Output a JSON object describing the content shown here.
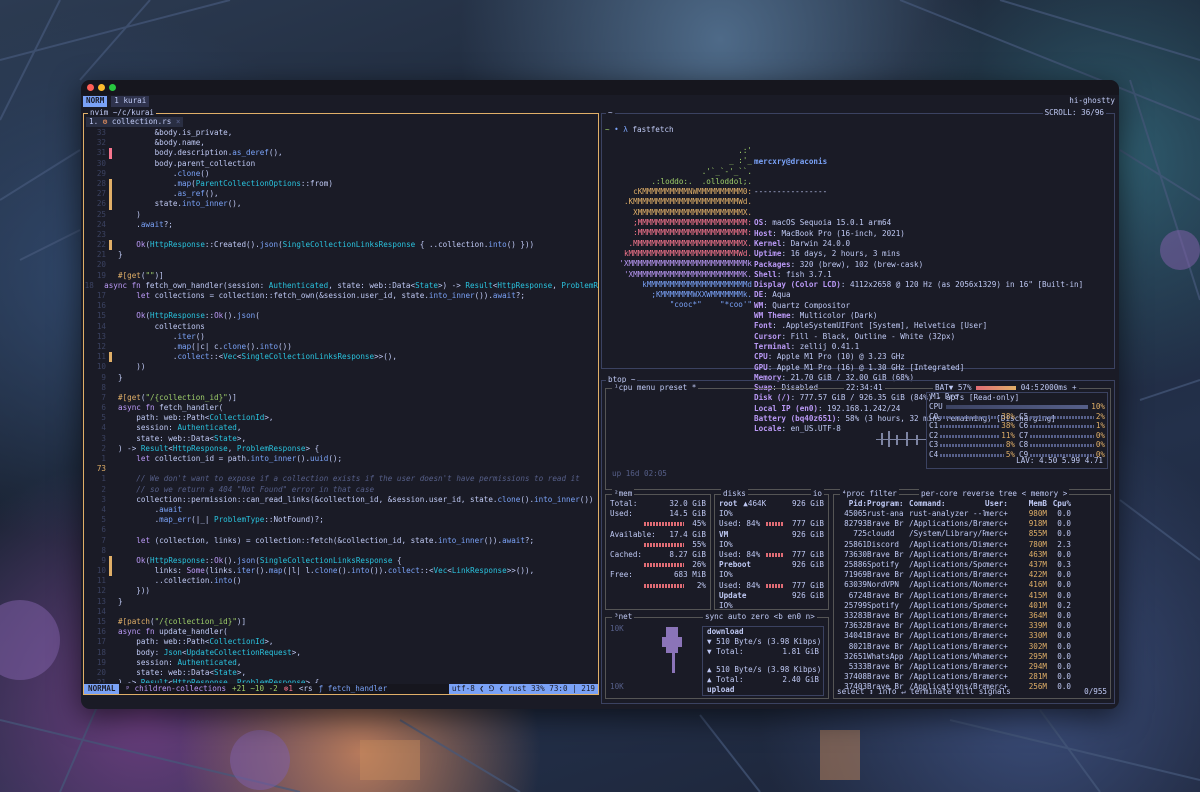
{
  "zellij": {
    "mode": "NORM",
    "tab": "1 kurai",
    "session": "hi-ghostty"
  },
  "nvim": {
    "pane_title": "nvim ~/c/kurai",
    "tab": {
      "index": "1.",
      "name": "collection.rs",
      "close": "×"
    },
    "status": {
      "mode": "NORMAL",
      "branch": "ᵖ children-collections",
      "diff": "+21 ~10 -2",
      "errors": "⊗1",
      "lsp": "<rs",
      "func": "ƒ fetch_handler",
      "enc": "utf-8",
      "icons": "❮ ⅁ ❮",
      "lang": "rust",
      "percent": "33%",
      "pos": "73:0 | 219"
    }
  },
  "fastfetch": {
    "prompt_dir": "~",
    "prompt_cmd": "fastfetch",
    "logo": [
      "                 .:'",
      "              _ :'_",
      "           .'`_`-'_``.",
      "  .:loddo:.  .olloddol;.",
      "  cKMMMMMMMMMMNWMMMMMMMMMM0:",
      ".KMMMMMMMMMMMMMMMMMMMMMMMWd.",
      "XMMMMMMMMMMMMMMMMMMMMMMMX.",
      ";MMMMMMMMMMMMMMMMMMMMMMMM:",
      ":MMMMMMMMMMMMMMMMMMMMMMMM:",
      ".MMMMMMMMMMMMMMMMMMMMMMMMX.",
      "kMMMMMMMMMMMMMMMMMMMMMMMMWd.",
      "'XMMMMMMMMMMMMMMMMMMMMMMMMMMk",
      "'XMMMMMMMMMMMMMMMMMMMMMMMMK.",
      "  kMMMMMMMMMMMMMMMMMMMMMMd",
      "   ;KMMMMMMMWXXWMMMMMMMk.",
      "     \"cooc*\"    \"*coo'\""
    ],
    "user": "mercxry@draconis",
    "sep": "----------------",
    "items": [
      {
        "k": "OS",
        "v": "macOS Sequoia 15.0.1 arm64"
      },
      {
        "k": "Host",
        "v": "MacBook Pro (16-inch, 2021)"
      },
      {
        "k": "Kernel",
        "v": "Darwin 24.0.0"
      },
      {
        "k": "Uptime",
        "v": "16 days, 2 hours, 3 mins"
      },
      {
        "k": "Packages",
        "v": "320 (brew), 102 (brew-cask)"
      },
      {
        "k": "Shell",
        "v": "fish 3.7.1"
      },
      {
        "k": "Display (Color LCD)",
        "v": "4112x2658 @ 120 Hz (as 2056x1329) in 16\" [Built-in]"
      },
      {
        "k": "DE",
        "v": "Aqua"
      },
      {
        "k": "WM",
        "v": "Quartz Compositor"
      },
      {
        "k": "WM Theme",
        "v": "Multicolor (Dark)"
      },
      {
        "k": "Font",
        "v": ".AppleSystemUIFont [System], Helvetica [User]"
      },
      {
        "k": "Cursor",
        "v": "Fill - Black, Outline - White (32px)"
      },
      {
        "k": "Terminal",
        "v": "zellij 0.41.1"
      },
      {
        "k": "CPU",
        "v": "Apple M1 Pro (10) @ 3.23 GHz"
      },
      {
        "k": "GPU",
        "v": "Apple M1 Pro (16) @ 1.30 GHz [Integrated]"
      },
      {
        "k": "Memory",
        "v": "21.70 GiB / 32.00 GiB (68%)"
      },
      {
        "k": "Swap",
        "v": "Disabled"
      },
      {
        "k": "Disk (/)",
        "v": "777.57 GiB / 926.35 GiB (84%) - apfs [Read-only]"
      },
      {
        "k": "Local IP (en0)",
        "v": "192.168.1.242/24"
      },
      {
        "k": "Battery (bq40z651)",
        "v": "58% (3 hours, 32 mins remaining) [Discharging]"
      },
      {
        "k": "Locale",
        "v": "en_US.UTF-8"
      }
    ]
  },
  "btop": {
    "pane_title": "btop ~",
    "header": {
      "cpu": "¹cpu",
      "menu": "menu",
      "preset": "preset *",
      "clock": "22:34:41",
      "battery": "BAT▼ 57%",
      "bat_time": "04:53",
      "interval": "2000ms +"
    },
    "uptime": "up 16d 02:05",
    "cpu_box": {
      "title": "M1 Pro",
      "total_label": "CPU",
      "total": "10%",
      "cores": [
        {
          "l": "C0",
          "v": "38%"
        },
        {
          "l": "C1",
          "v": "38%"
        },
        {
          "l": "C2",
          "v": "11%"
        },
        {
          "l": "C3",
          "v": "8%"
        },
        {
          "l": "C4",
          "v": "5%"
        },
        {
          "l": "C5",
          "v": "2%"
        },
        {
          "l": "C6",
          "v": "1%"
        },
        {
          "l": "C7",
          "v": "0%"
        },
        {
          "l": "C8",
          "v": "0%"
        },
        {
          "l": "C9",
          "v": "0%"
        }
      ],
      "lav": "LAV: 4.50 5.99 4.71"
    },
    "mem": {
      "title": "²mem",
      "rows": [
        {
          "k": "Total:",
          "v": "32.0 GiB"
        },
        {
          "k": "Used:",
          "v": "14.5 GiB"
        },
        {
          "k": "",
          "v": "45%"
        },
        {
          "k": "Available:",
          "v": "17.4 GiB"
        },
        {
          "k": "",
          "v": "55%"
        },
        {
          "k": "Cached:",
          "v": "8.27 GiB"
        },
        {
          "k": "",
          "v": "26%"
        },
        {
          "k": "Free:",
          "v": "683 MiB"
        },
        {
          "k": "",
          "v": "2%"
        }
      ]
    },
    "disks": {
      "title": "disks",
      "io": "io",
      "rows": [
        {
          "k": "root",
          "m": "▲464K",
          "v": "926 GiB"
        },
        {
          "k": "IO%",
          "m": "",
          "v": ""
        },
        {
          "k": "Used: 84%",
          "m": "",
          "v": "777 GiB"
        },
        {
          "k": "VM",
          "m": "",
          "v": "926 GiB"
        },
        {
          "k": "IO%",
          "m": "",
          "v": ""
        },
        {
          "k": "Used: 84%",
          "m": "",
          "v": "777 GiB"
        },
        {
          "k": "Preboot",
          "m": "",
          "v": "926 GiB"
        },
        {
          "k": "IO%",
          "m": "",
          "v": ""
        },
        {
          "k": "Used: 84%",
          "m": "",
          "v": "777 GiB"
        },
        {
          "k": "Update",
          "m": "",
          "v": "926 GiB"
        },
        {
          "k": "IO%",
          "m": "",
          "v": ""
        }
      ]
    },
    "net": {
      "title": "³net",
      "sync": "sync",
      "auto": "auto",
      "zero": "zero",
      "iface": "<b en0 n>",
      "scale_top": "10K",
      "scale_bot": "10K",
      "down_title": "download",
      "down_rate": "▼ 510 Byte/s (3.98 Kibps)",
      "down_total_k": "▼ Total:",
      "down_total_v": "1.81 GiB",
      "up_rate": "▲ 510 Byte/s (3.98 Kibps)",
      "up_total_k": "▲ Total:",
      "up_total_v": "2.40 GiB",
      "up_title": "upload"
    },
    "proc": {
      "title": "⁴proc",
      "filter": "filter",
      "tabs": "per-core reverse tree < memory >",
      "cols": [
        "Pid:",
        "Program:",
        "Command:",
        "User:",
        "MemB",
        "Cpu%"
      ],
      "rows": [
        [
          "45065",
          "rust-ana",
          "rust-analyzer --l",
          "merc+",
          "980M",
          "0.0"
        ],
        [
          "82793",
          "Brave Br",
          "/Applications/Bra",
          "merc+",
          "918M",
          "0.0"
        ],
        [
          "725",
          "cloudd",
          "/System/Library/P",
          "merc+",
          "855M",
          "0.0"
        ],
        [
          "25861",
          "Discord",
          "/Applications/Dis",
          "merc+",
          "780M",
          "2.3"
        ],
        [
          "73630",
          "Brave Br",
          "/Applications/Bra",
          "merc+",
          "463M",
          "0.0"
        ],
        [
          "25886",
          "Spotify",
          "/Applications/Spo",
          "merc+",
          "437M",
          "0.3"
        ],
        [
          "71969",
          "Brave Br",
          "/Applications/Bra",
          "merc+",
          "422M",
          "0.0"
        ],
        [
          "63039",
          "NordVPN",
          "/Applications/Nor",
          "merc+",
          "416M",
          "0.0"
        ],
        [
          "6724",
          "Brave Br",
          "/Applications/Bra",
          "merc+",
          "415M",
          "0.0"
        ],
        [
          "25799",
          "Spotify",
          "/Applications/Spo",
          "merc+",
          "401M",
          "0.2"
        ],
        [
          "33283",
          "Brave Br",
          "/Applications/Bra",
          "merc+",
          "364M",
          "0.0"
        ],
        [
          "73632",
          "Brave Br",
          "/Applications/Bra",
          "merc+",
          "339M",
          "0.0"
        ],
        [
          "34041",
          "Brave Br",
          "/Applications/Bra",
          "merc+",
          "330M",
          "0.0"
        ],
        [
          "8021",
          "Brave Br",
          "/Applications/Bra",
          "merc+",
          "302M",
          "0.0"
        ],
        [
          "32651",
          "WhatsApp",
          "/Applications/Wha",
          "merc+",
          "295M",
          "0.0"
        ],
        [
          "5333",
          "Brave Br",
          "/Applications/Bra",
          "merc+",
          "294M",
          "0.0"
        ],
        [
          "37408",
          "Brave Br",
          "/Applications/Bra",
          "merc+",
          "281M",
          "0.0"
        ],
        [
          "37403",
          "Brave Br",
          "/Applications/Bra",
          "merc+",
          "256M",
          "0.0"
        ]
      ],
      "footer": "select ↕ info ↵ terminate kill signals",
      "count": "0/955"
    }
  },
  "code_lines": [
    {
      "n": "33",
      "t": "        &body.is_private,",
      "g": ""
    },
    {
      "n": "32",
      "t": "        &body.name,",
      "g": ""
    },
    {
      "n": "31",
      "t": "        body.description.as_deref(),",
      "g": "d"
    },
    {
      "n": "30",
      "t": "        body.parent_collection",
      "g": ""
    },
    {
      "n": "29",
      "t": "            .clone()",
      "g": ""
    },
    {
      "n": "28",
      "t": "            .map(ParentCollectionOptions::from)",
      "g": "m"
    },
    {
      "n": "27",
      "t": "            .as_ref(),",
      "g": "m"
    },
    {
      "n": "26",
      "t": "        state.into_inner(),",
      "g": "m"
    },
    {
      "n": "25",
      "t": "    )",
      "g": ""
    },
    {
      "n": "24",
      "t": "    .await?;",
      "g": ""
    },
    {
      "n": "23",
      "t": "",
      "g": ""
    },
    {
      "n": "22",
      "t": "    Ok(HttpResponse::Created().json(SingleCollectionLinksResponse { ..collection.into() }))",
      "g": "m"
    },
    {
      "n": "21",
      "t": "}",
      "g": ""
    },
    {
      "n": "20",
      "t": "",
      "g": ""
    },
    {
      "n": "19",
      "t": "#[get(\"\")]",
      "g": ""
    },
    {
      "n": "18",
      "t": "async fn fetch_own_handler(session: Authenticated, state: web::Data<State>) -> Result<HttpResponse, ProblemR",
      "g": ""
    },
    {
      "n": "17",
      "t": "    let collections = collection::fetch_own(&session.user_id, state.into_inner()).await?;",
      "g": ""
    },
    {
      "n": "16",
      "t": "",
      "g": ""
    },
    {
      "n": "15",
      "t": "    Ok(HttpResponse::Ok().json(",
      "g": ""
    },
    {
      "n": "14",
      "t": "        collections",
      "g": ""
    },
    {
      "n": "13",
      "t": "            .iter()",
      "g": ""
    },
    {
      "n": "12",
      "t": "            .map(|c| c.clone().into())",
      "g": ""
    },
    {
      "n": "11",
      "t": "            .collect::<Vec<SingleCollectionLinksResponse>>(),",
      "g": "m"
    },
    {
      "n": "10",
      "t": "    ))",
      "g": ""
    },
    {
      "n": "9",
      "t": "}",
      "g": ""
    },
    {
      "n": "8",
      "t": "",
      "g": ""
    },
    {
      "n": "7",
      "t": "#[get(\"/{collection_id}\")]",
      "g": ""
    },
    {
      "n": "6",
      "t": "async fn fetch_handler(",
      "g": ""
    },
    {
      "n": "5",
      "t": "    path: web::Path<CollectionId>,",
      "g": ""
    },
    {
      "n": "4",
      "t": "    session: Authenticated,",
      "g": ""
    },
    {
      "n": "3",
      "t": "    state: web::Data<State>,",
      "g": ""
    },
    {
      "n": "2",
      "t": ") -> Result<HttpResponse, ProblemResponse> {",
      "g": ""
    },
    {
      "n": "1",
      "t": "    let collection_id = path.into_inner().uuid();",
      "g": ""
    },
    {
      "n": "73",
      "t": "",
      "g": "",
      "cur": true
    },
    {
      "n": "1",
      "t": "    // We don't want to expose if a collection exists if the user doesn't have permissions to read it",
      "g": ""
    },
    {
      "n": "2",
      "t": "    // so we return a 404 \"Not Found\" error in that case",
      "g": ""
    },
    {
      "n": "3",
      "t": "    collection::permission::can_read_links(&collection_id, &session.user_id, state.clone().into_inner())",
      "g": ""
    },
    {
      "n": "4",
      "t": "        .await",
      "g": ""
    },
    {
      "n": "5",
      "t": "        .map_err(|_| ProblemType::NotFound)?;",
      "g": ""
    },
    {
      "n": "6",
      "t": "",
      "g": ""
    },
    {
      "n": "7",
      "t": "    let (collection, links) = collection::fetch(&collection_id, state.into_inner()).await?;",
      "g": ""
    },
    {
      "n": "8",
      "t": "",
      "g": ""
    },
    {
      "n": "9",
      "t": "    Ok(HttpResponse::Ok().json(SingleCollectionLinksResponse {",
      "g": "m"
    },
    {
      "n": "10",
      "t": "        links: Some(links.iter().map(|l| l.clone().into()).collect::<Vec<LinkResponse>>()),",
      "g": "m"
    },
    {
      "n": "11",
      "t": "        ..collection.into()",
      "g": ""
    },
    {
      "n": "12",
      "t": "    }))",
      "g": ""
    },
    {
      "n": "13",
      "t": "}",
      "g": ""
    },
    {
      "n": "14",
      "t": "",
      "g": ""
    },
    {
      "n": "15",
      "t": "#[patch(\"/{collection_id}\")]",
      "g": ""
    },
    {
      "n": "16",
      "t": "async fn update_handler(",
      "g": ""
    },
    {
      "n": "17",
      "t": "    path: web::Path<CollectionId>,",
      "g": ""
    },
    {
      "n": "18",
      "t": "    body: Json<UpdateCollectionRequest>,",
      "g": ""
    },
    {
      "n": "19",
      "t": "    session: Authenticated,",
      "g": ""
    },
    {
      "n": "20",
      "t": "    state: web::Data<State>,",
      "g": ""
    },
    {
      "n": "21",
      "t": ") -> Result<HttpResponse, ProblemResponse> {",
      "g": ""
    },
    {
      "n": "22",
      "t": "    let collection_id = path.into_inner().uuid();",
      "g": ""
    },
    {
      "n": "23",
      "t": "",
      "g": ""
    },
    {
      "n": "24",
      "t": "    collection::permission::can_update(&collection_id, &session.user_id, state.clone().into_inner())",
      "g": ""
    }
  ],
  "colors": {
    "accent": "#7aa2f7",
    "warn": "#e0af68",
    "bg": "#1a1b26"
  }
}
